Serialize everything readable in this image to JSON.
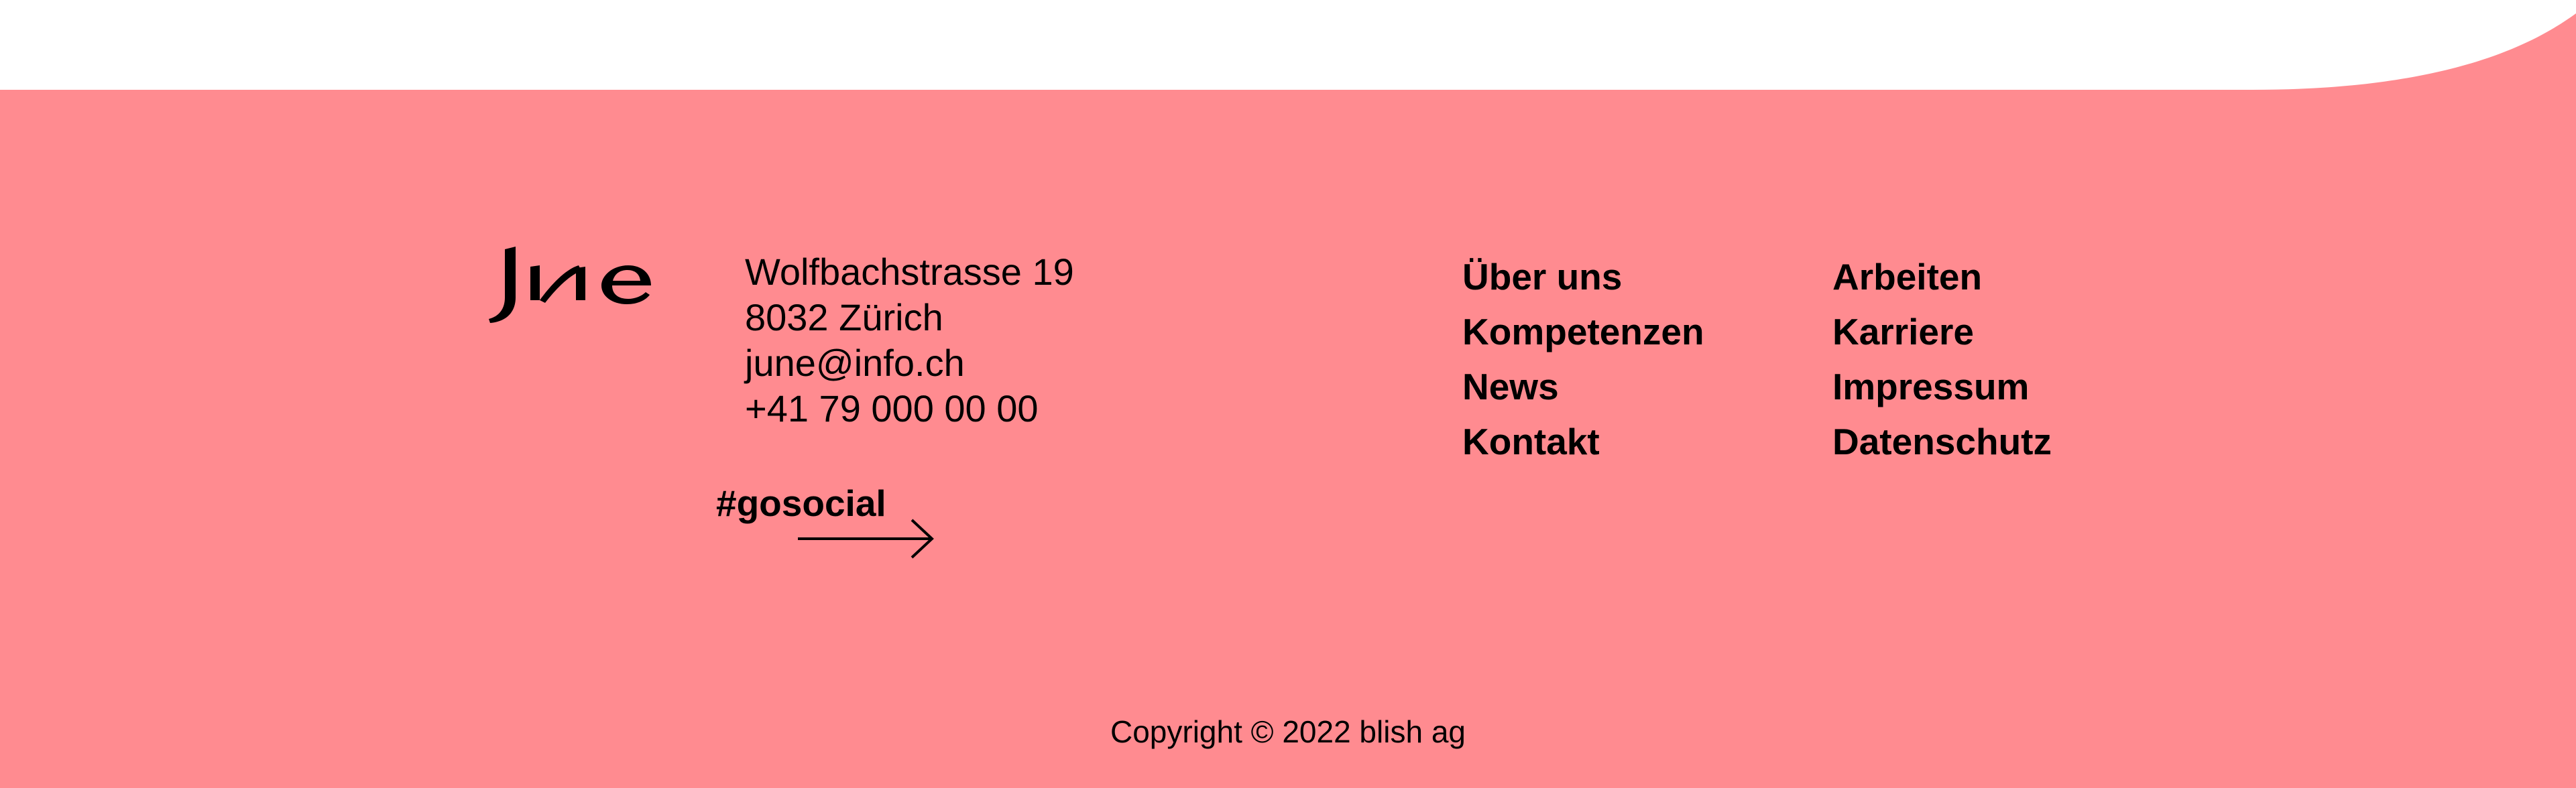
{
  "colors": {
    "footer_bg": "#ff8b90",
    "page_bg": "#ffffff",
    "text": "#000000"
  },
  "brand": {
    "logo_text": "June"
  },
  "address": {
    "street": "Wolfbachstrasse 19",
    "city": "8032 Zürich",
    "email": "june@info.ch",
    "phone": "+41 79 000 00 00"
  },
  "social": {
    "label": "#gosocial",
    "icon": "arrow-right-icon"
  },
  "nav": {
    "column1": [
      "Über uns",
      "Kompetenzen",
      "News",
      "Kontakt"
    ],
    "column2": [
      "Arbeiten",
      "Karriere",
      "Impressum",
      "Datenschutz"
    ]
  },
  "copyright": "Copyright © 2022 blish ag"
}
